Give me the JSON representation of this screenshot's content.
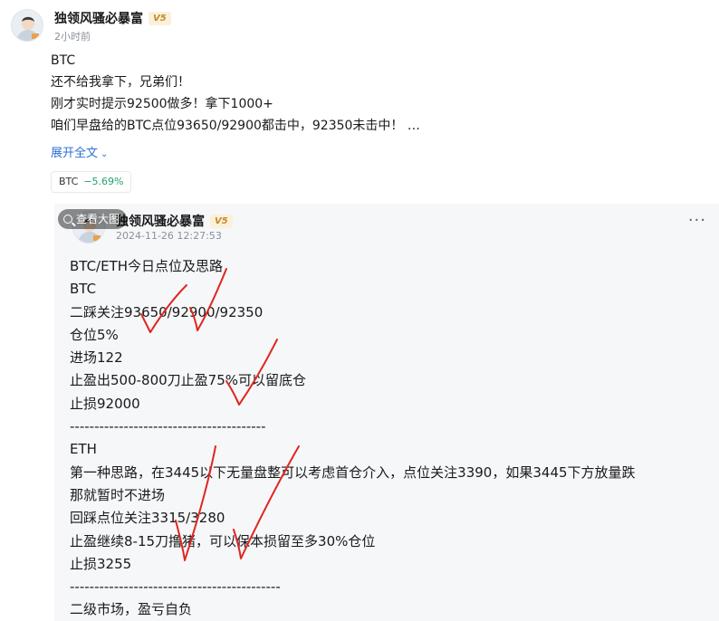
{
  "post": {
    "author": "独领风骚必暴富",
    "badge": "V5",
    "time": "2小时前",
    "lines": [
      "BTC",
      "还不给我拿下，兄弟们！",
      "刚才实时提示92500做多！拿下1000+",
      "咱们早盘给的BTC点位93650/92900都击中，92350未击中！  …"
    ],
    "expand_label": "展开全文",
    "ticker": {
      "symbol": "BTC",
      "change": "−5.69%",
      "change_color": "#1ea36a"
    }
  },
  "embed": {
    "zoom_label": "查看大图",
    "author": "独领风骚必暴富",
    "badge": "V5",
    "time": "2024-11-26 12:27:53",
    "lines": [
      "BTC/ETH今日点位及思路",
      "BTC",
      "二踩关注93650/92900/92350",
      "仓位5%",
      "进场122",
      "止盈出500-800刀止盈75%可以留底仓",
      "止损92000",
      "----------------------------------------",
      "ETH",
      "第一种思路，在3445以下无量盘整可以考虑首仓介入，点位关注3390，如果3445下方放量跌",
      "那就暂时不进场",
      "回踩点位关注3315/3280",
      "止盈继续8-15刀撸猪，可以保本损留至多30%仓位",
      "止损3255",
      "-------------------------------------------",
      "二级市场，盈亏自负"
    ]
  },
  "colors": {
    "link": "#2c6fd6",
    "badge": "#c48a2c",
    "annotation": "#e0261e"
  },
  "icons": [
    "avatar",
    "chevron-down-icon",
    "magnifier-icon",
    "more-icon"
  ]
}
